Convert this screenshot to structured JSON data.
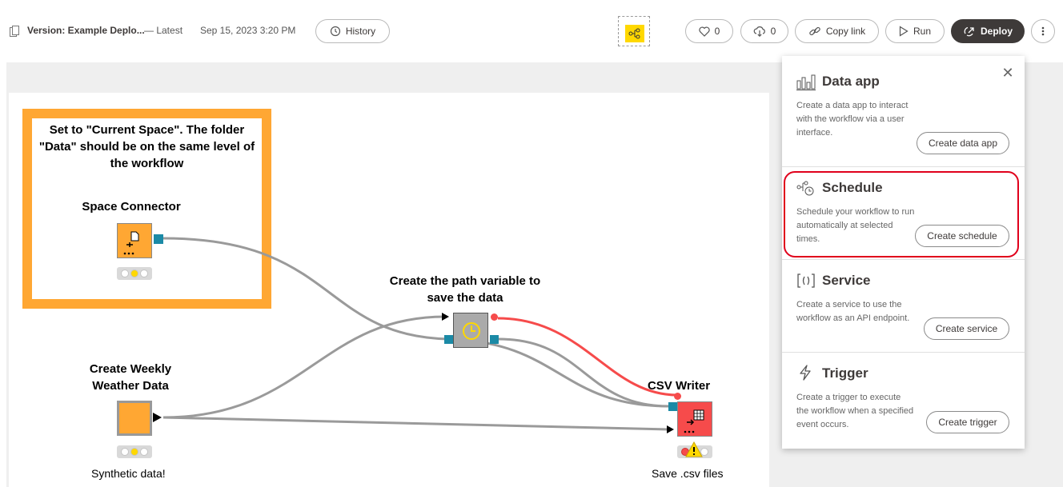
{
  "header": {
    "version_title": "Version: Example Deplo...",
    "latest": "— Latest",
    "date": "Sep 15, 2023 3:20 PM",
    "history_label": "History",
    "likes": "0",
    "downloads": "0",
    "copy_link_label": "Copy link",
    "run_label": "Run",
    "deploy_label": "Deploy"
  },
  "workflow": {
    "annotation": "Set to \"Current Space\". The folder \"Data\" should be on the same level of the workflow",
    "nodes": {
      "space_connector": {
        "label": "Space Connector",
        "color": "#ffa733"
      },
      "path_variable": {
        "label": "Create the path variable to save the data",
        "color": "#aaaaaa"
      },
      "weather_data": {
        "label": "Create Weekly Weather Data",
        "caption": "Synthetic data!",
        "color": "#ffa733"
      },
      "csv_writer": {
        "label": "CSV Writer",
        "caption": "Save .csv files",
        "color": "#f64b4b"
      }
    }
  },
  "deploy_panel": {
    "sections": [
      {
        "title": "Data app",
        "icon": "data-app-icon",
        "description": "Create a data app to interact with the workflow via a user interface.",
        "button": "Create data app"
      },
      {
        "title": "Schedule",
        "icon": "schedule-icon",
        "description": "Schedule your workflow to run automatically at selected times.",
        "button": "Create schedule"
      },
      {
        "title": "Service",
        "icon": "service-icon",
        "description": "Create a service to use the workflow as an API endpoint.",
        "button": "Create service"
      },
      {
        "title": "Trigger",
        "icon": "trigger-icon",
        "description": "Create a trigger to execute the workflow when a specified event occurs.",
        "button": "Create trigger"
      }
    ]
  },
  "colors": {
    "annotation_border": "#ffa733",
    "flow_variable_wire": "#f64b4b",
    "highlight": "#e0001b",
    "deploy_button": "#3e3a39"
  }
}
